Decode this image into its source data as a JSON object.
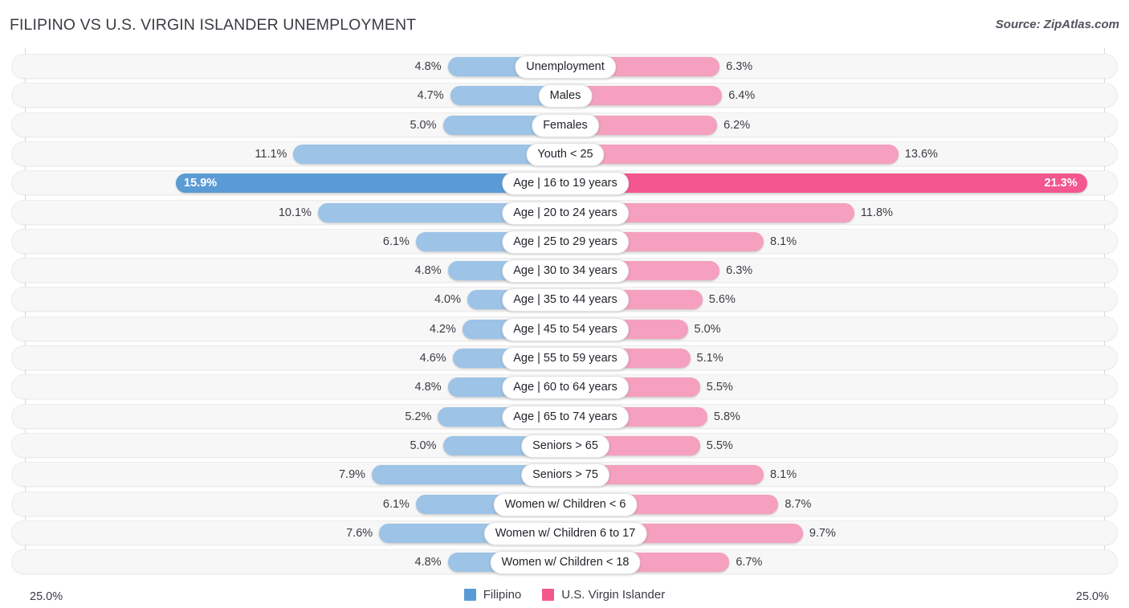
{
  "header": {
    "title": "FILIPINO VS U.S. VIRGIN ISLANDER UNEMPLOYMENT",
    "source": "Source: ZipAtlas.com"
  },
  "axis": {
    "left_label": "25.0%",
    "right_label": "25.0%",
    "max": 25.0
  },
  "legend": {
    "items": [
      {
        "label": "Filipino",
        "color": "#5B9BD5"
      },
      {
        "label": "U.S. Virgin Islander",
        "color": "#F4578E"
      }
    ]
  },
  "colors": {
    "left_normal": "#9DC3E6",
    "left_max": "#5B9BD5",
    "right_normal": "#F5A0BE",
    "right_max": "#F4578E",
    "track": "#f7f7f7",
    "text": "#3b3b44"
  },
  "chart_data": {
    "type": "bar",
    "orientation": "horizontal-diverging",
    "title": "FILIPINO VS U.S. VIRGIN ISLANDER UNEMPLOYMENT",
    "subtitle": "",
    "xlabel": "",
    "ylabel": "",
    "xlim": [
      25.0,
      25.0
    ],
    "grid": false,
    "legend_position": "bottom-center",
    "categories": [
      "Unemployment",
      "Males",
      "Females",
      "Youth < 25",
      "Age | 16 to 19 years",
      "Age | 20 to 24 years",
      "Age | 25 to 29 years",
      "Age | 30 to 34 years",
      "Age | 35 to 44 years",
      "Age | 45 to 54 years",
      "Age | 55 to 59 years",
      "Age | 60 to 64 years",
      "Age | 65 to 74 years",
      "Seniors > 65",
      "Seniors > 75",
      "Women w/ Children < 6",
      "Women w/ Children 6 to 17",
      "Women w/ Children < 18"
    ],
    "series": [
      {
        "name": "Filipino",
        "values": [
          4.8,
          4.7,
          5.0,
          11.1,
          15.9,
          10.1,
          6.1,
          4.8,
          4.0,
          4.2,
          4.6,
          4.8,
          5.2,
          5.0,
          7.9,
          6.1,
          7.6,
          4.8
        ],
        "labels": [
          "4.8%",
          "4.7%",
          "5.0%",
          "11.1%",
          "15.9%",
          "10.1%",
          "6.1%",
          "4.8%",
          "4.0%",
          "4.2%",
          "4.6%",
          "4.8%",
          "5.2%",
          "5.0%",
          "7.9%",
          "6.1%",
          "7.6%",
          "4.8%"
        ]
      },
      {
        "name": "U.S. Virgin Islander",
        "values": [
          6.3,
          6.4,
          6.2,
          13.6,
          21.3,
          11.8,
          8.1,
          6.3,
          5.6,
          5.0,
          5.1,
          5.5,
          5.8,
          5.5,
          8.1,
          8.7,
          9.7,
          6.7
        ],
        "labels": [
          "6.3%",
          "6.4%",
          "6.2%",
          "13.6%",
          "21.3%",
          "11.8%",
          "8.1%",
          "6.3%",
          "5.6%",
          "5.0%",
          "5.1%",
          "5.5%",
          "5.8%",
          "5.5%",
          "8.1%",
          "8.7%",
          "9.7%",
          "6.7%"
        ]
      }
    ],
    "highlight_row_index": 4
  }
}
